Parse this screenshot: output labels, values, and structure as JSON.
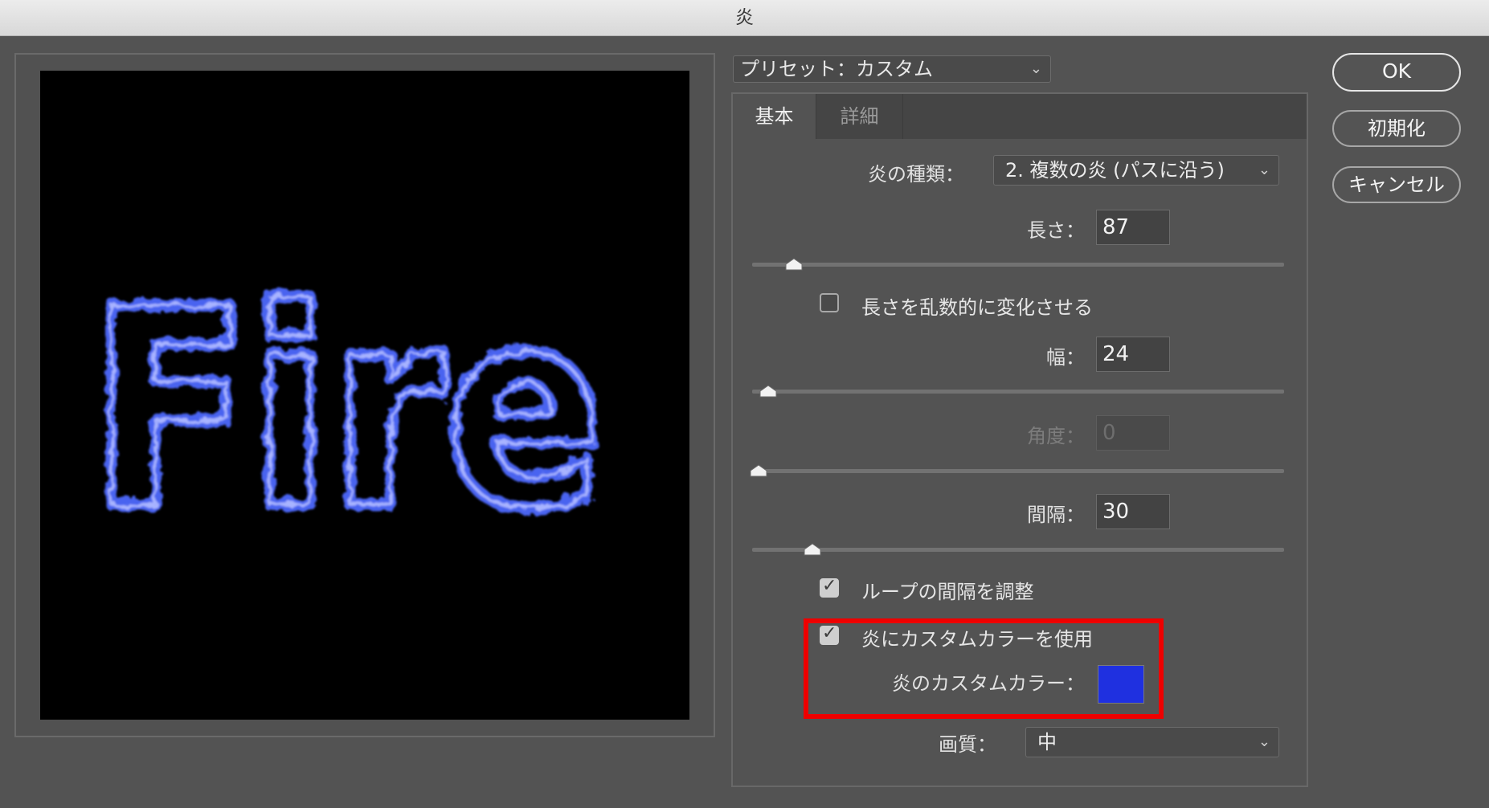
{
  "window": {
    "title": "炎"
  },
  "preset": {
    "label": "プリセット：カスタム"
  },
  "tabs": {
    "basic": "基本",
    "detail": "詳細"
  },
  "flame_type": {
    "label": "炎の種類：",
    "value": "2. 複数の炎 (パスに沿う)"
  },
  "length": {
    "label": "長さ：",
    "value": "87"
  },
  "randomize_length": {
    "label": "長さを乱数的に変化させる",
    "checked": false
  },
  "width": {
    "label": "幅：",
    "value": "24"
  },
  "angle": {
    "label": "角度：",
    "value": "0",
    "enabled": false
  },
  "interval": {
    "label": "間隔：",
    "value": "30"
  },
  "adjust_loop": {
    "label": "ループの間隔を調整",
    "checked": true
  },
  "custom_color": {
    "label": "炎にカスタムカラーを使用",
    "checked": true
  },
  "custom_color_swatch": {
    "label": "炎のカスタムカラー：",
    "color": "#1f30e0"
  },
  "quality": {
    "label": "画質：",
    "value": "中"
  },
  "buttons": {
    "ok": "OK",
    "reset": "初期化",
    "cancel": "キャンセル"
  },
  "preview": {
    "text": "Fire",
    "flame_color": "#4a63f0"
  },
  "colors": {
    "highlight": "#ee0000",
    "dialog_bg": "#535353"
  }
}
